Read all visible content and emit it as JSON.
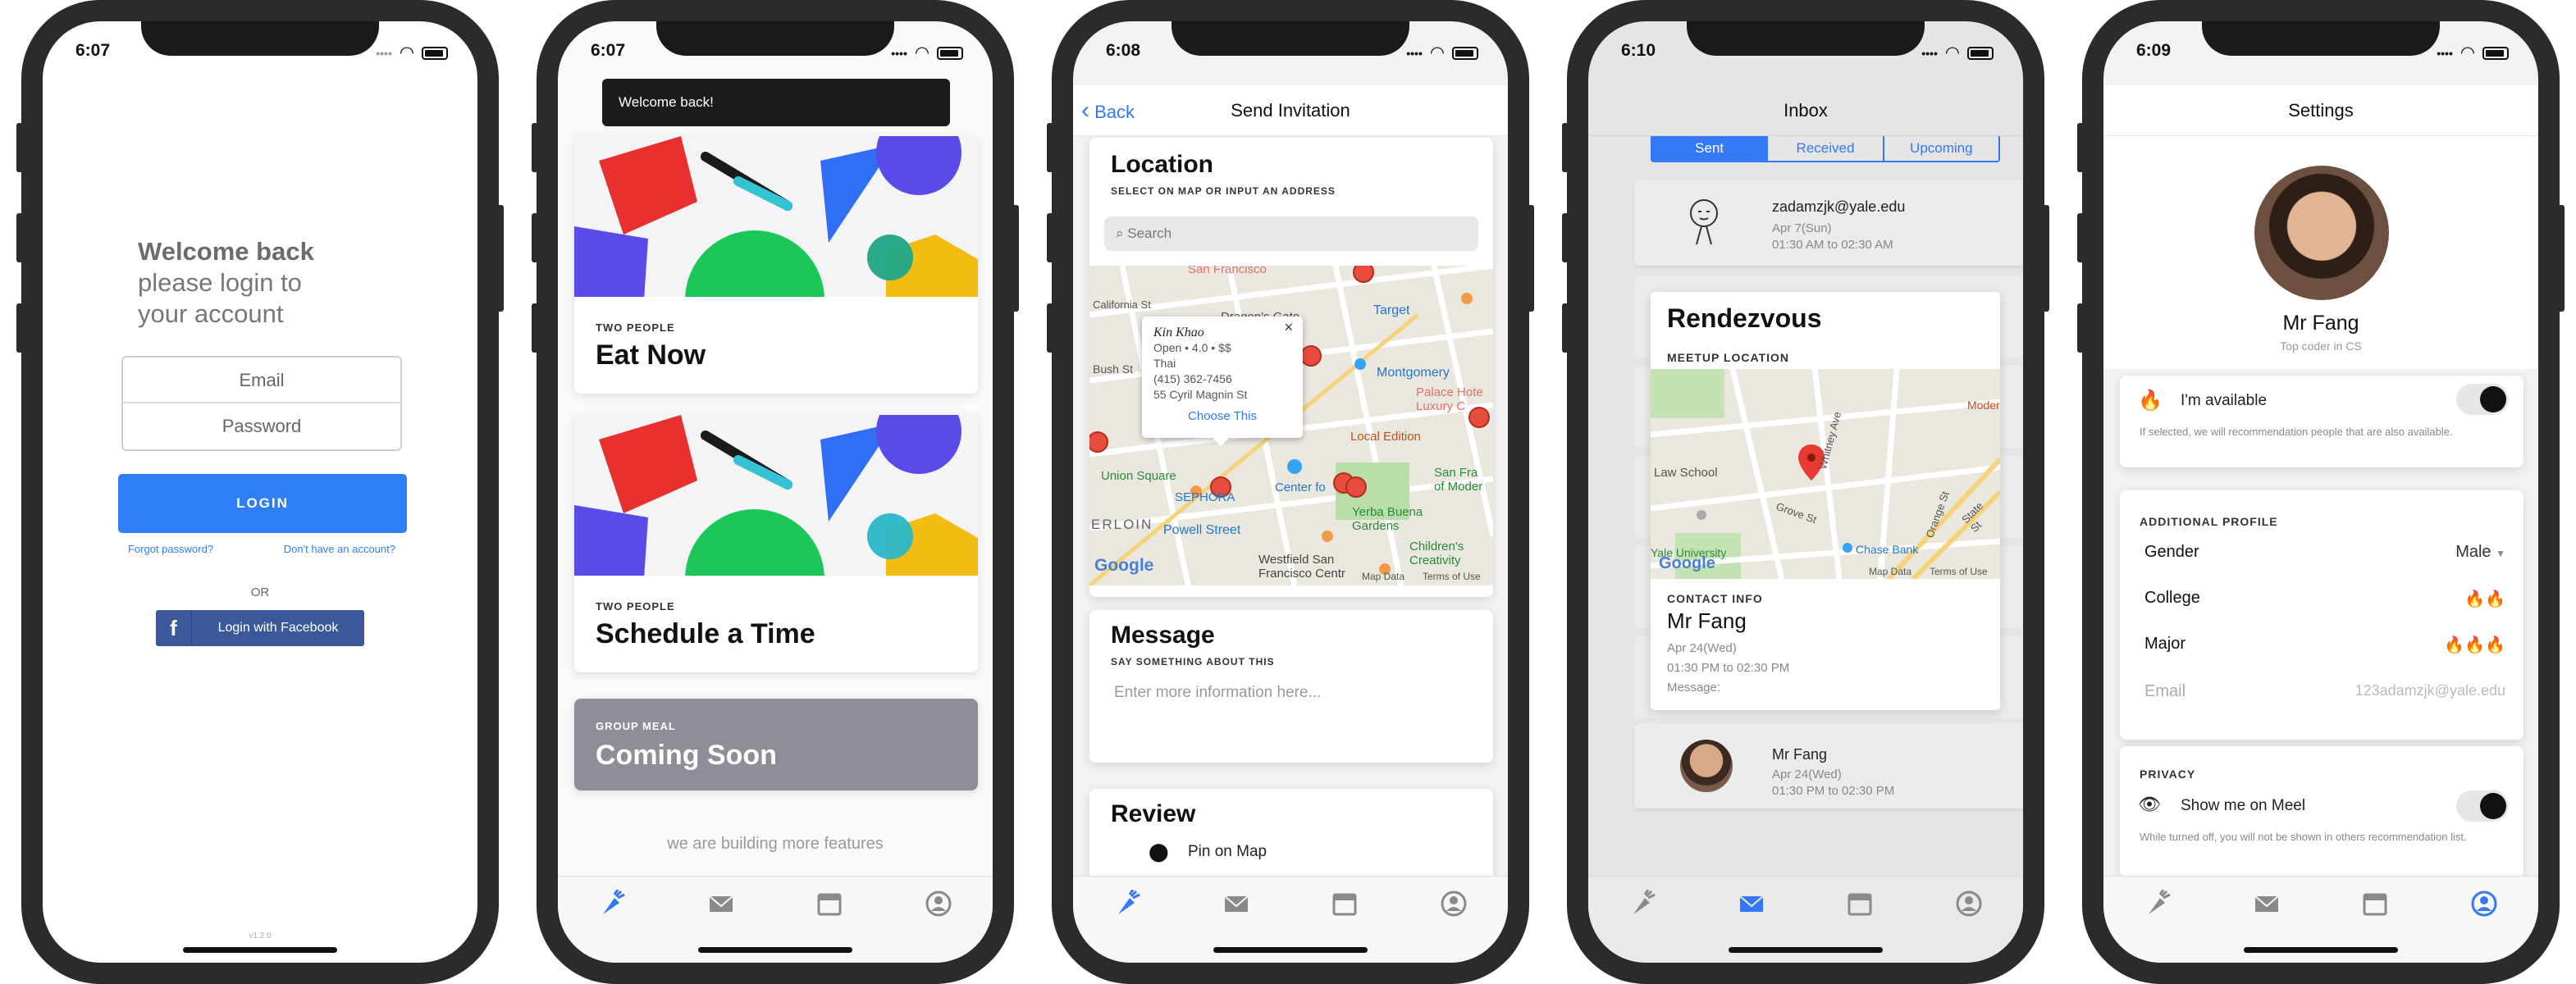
{
  "screens": [
    {
      "time": "6:07",
      "login": {
        "welcome_bold": "Welcome back",
        "welcome_line2": "please login to",
        "welcome_line3": "your account",
        "email_placeholder": "Email",
        "password_placeholder": "Password",
        "login_label": "LOGIN",
        "forgot_label": "Forgot password?",
        "signup_label": "Don't have an account?",
        "or_label": "OR",
        "facebook_label": "Login with Facebook",
        "version": "v1.2.0"
      }
    },
    {
      "time": "6:07",
      "toast": "Welcome back!",
      "cards": [
        {
          "tag": "TWO PEOPLE",
          "title": "Eat Now"
        },
        {
          "tag": "TWO PEOPLE",
          "title": "Schedule a Time"
        },
        {
          "tag": "GROUP MEAL",
          "title": "Coming Soon"
        }
      ],
      "footer_note": "we are building more features"
    },
    {
      "time": "6:08",
      "nav": {
        "back_label": "Back",
        "title": "Send Invitation"
      },
      "location": {
        "title": "Location",
        "subtitle": "SELECT ON MAP OR INPUT AN ADDRESS",
        "search_placeholder": "Search"
      },
      "map": {
        "labels": [
          "Union Square",
          "SEPHORA",
          "Powell Street",
          "Westfield San Francisco Centre",
          "Yerba Buena Gardens",
          "Children's Creativity Museum",
          "Center for the Arts",
          "Local Edition",
          "Montgomery",
          "Target",
          "Palace Hotel, a Luxury Collection",
          "San Francisco Museum of Modern Art",
          "Dragon's Gate",
          "San Francisco",
          "Bush St",
          "California St",
          "ERLOIN",
          "Map Data",
          "Terms of Use",
          "Google"
        ],
        "popup": {
          "name": "Kin Khao",
          "line1": "Open • 4.0 • $$",
          "line2": "Thai",
          "line3": "(415) 362-7456",
          "line4": "55 Cyril Magnin St",
          "action": "Choose This",
          "close": "×"
        }
      },
      "message": {
        "title": "Message",
        "subtitle": "SAY SOMETHING ABOUT THIS",
        "placeholder": "Enter more information here..."
      },
      "review": {
        "title": "Review",
        "pin_label": "Pin on Map"
      }
    },
    {
      "time": "6:10",
      "nav_title": "Inbox",
      "segments": [
        "Sent",
        "Received",
        "Upcoming"
      ],
      "selected_segment": "Sent",
      "items": [
        {
          "name": "zadamzjk@yale.edu",
          "date": "Apr 7(Sun)",
          "time": "01:30 AM to 02:30 AM"
        },
        {
          "name": "Mr Fang",
          "date": "Apr 24(Wed)",
          "time": "01:30 PM to 02:30 PM"
        }
      ],
      "detail": {
        "title": "Rendezvous",
        "subtitle": "MEETUP LOCATION",
        "map_labels": [
          "Law School",
          "Whitney Ave",
          "Grove St",
          "Orange St",
          "State St",
          "Chase Bank",
          "Yale University",
          "Modern",
          "Map Data",
          "Terms of Use",
          "Google"
        ],
        "contact_label": "CONTACT INFO",
        "contact_name": "Mr Fang",
        "date": "Apr 24(Wed)",
        "time": "01:30 PM to 02:30 PM",
        "message_label": "Message:"
      }
    },
    {
      "time": "6:09",
      "nav_title": "Settings",
      "profile": {
        "name": "Mr Fang",
        "subtitle": "Top coder in CS"
      },
      "available": {
        "label": "I'm available",
        "note": "If selected, we will recommendation people that are also available."
      },
      "additional": {
        "header": "ADDITIONAL PROFILE",
        "rows": [
          {
            "label": "Gender",
            "value": "Male"
          },
          {
            "label": "College",
            "value": "🔥🔥"
          },
          {
            "label": "Major",
            "value": "🔥🔥🔥"
          },
          {
            "label": "Email",
            "value": "123adamzjk@yale.edu"
          }
        ]
      },
      "privacy": {
        "header": "PRIVACY",
        "label": "Show me on Meel",
        "note": "While turned off, you will not be shown in others recommendation list."
      }
    }
  ],
  "colors": {
    "accent": "#3478f6",
    "login_button": "#2f7ef5",
    "facebook": "#3b5998",
    "disabled_card": "#8e8e98",
    "toast": "#1c1c1e"
  }
}
